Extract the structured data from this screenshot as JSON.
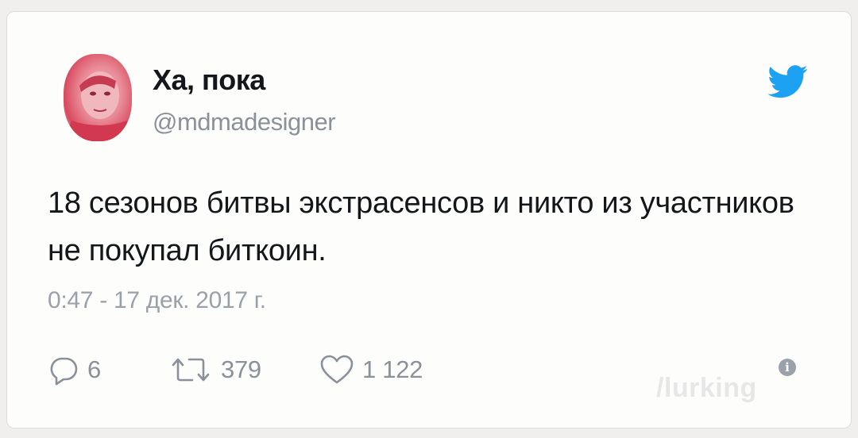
{
  "tweet": {
    "display_name": "Ха, пока",
    "handle": "@mdmadesigner",
    "text": "18 сезонов битвы экстрасенсов и никто из участников не покупал биткоин.",
    "timestamp": "0:47 - 17 дек. 2017 г.",
    "replies": "6",
    "retweets": "379",
    "likes": "1 122"
  },
  "icons": {
    "logo": "twitter-bird-icon",
    "reply": "reply-bubble-icon",
    "retweet": "retweet-arrows-icon",
    "like": "heart-icon",
    "info": "info-icon"
  },
  "watermark": "/lurking",
  "colors": {
    "twitter_blue": "#1da1f2",
    "text": "#14171a",
    "muted": "#8a9199"
  }
}
